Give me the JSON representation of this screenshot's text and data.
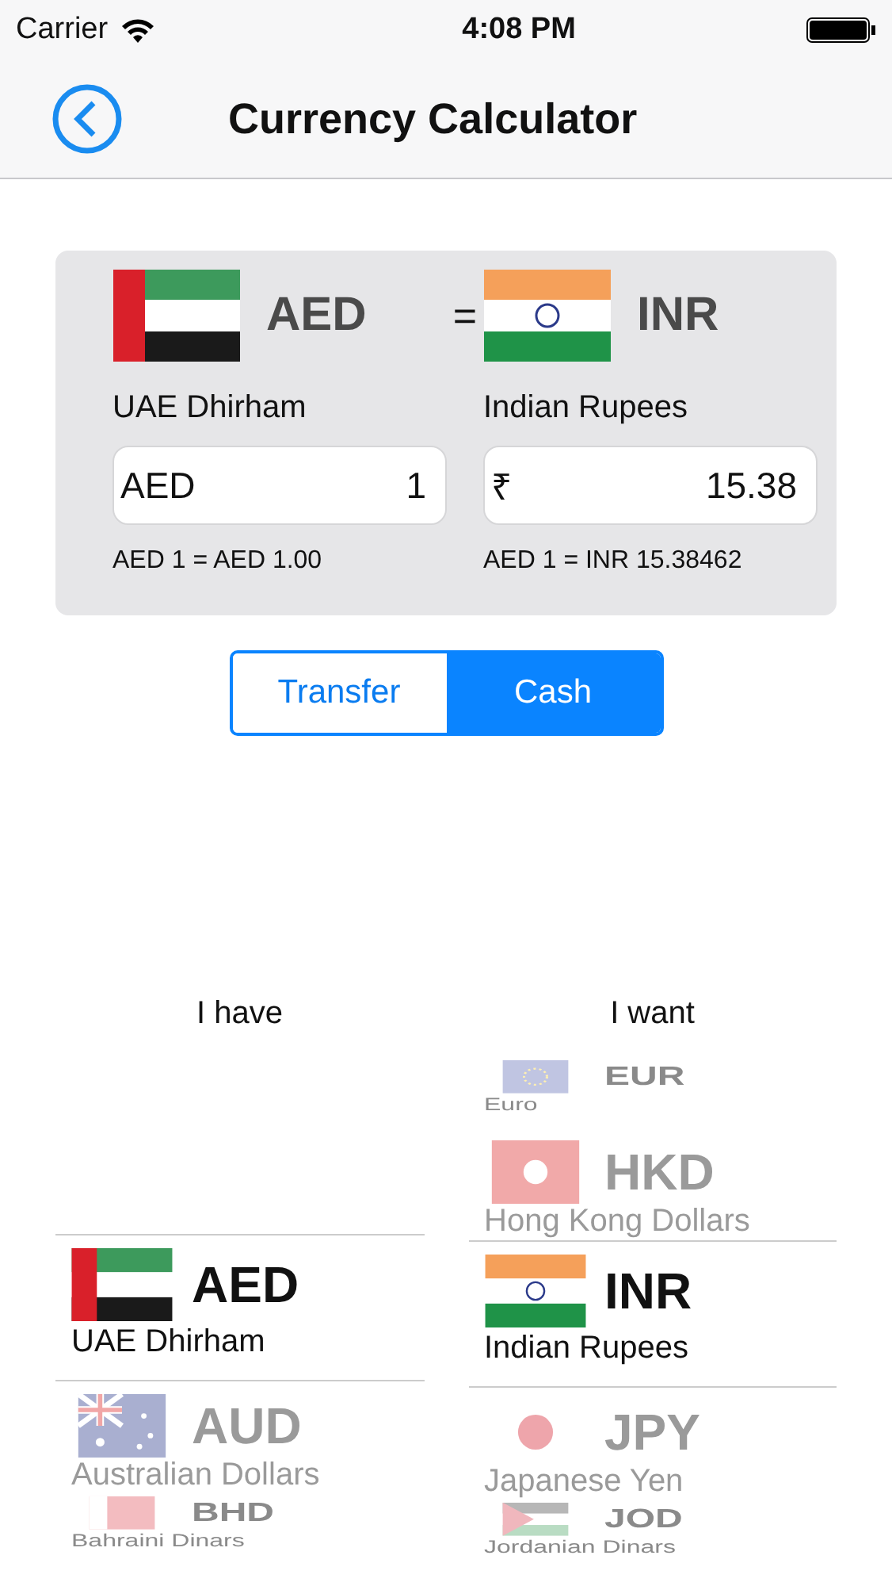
{
  "status_bar": {
    "carrier": "Carrier",
    "time": "4:08 PM"
  },
  "nav": {
    "title": "Currency Calculator"
  },
  "converter": {
    "from": {
      "kind": "uae",
      "code": "AED",
      "name": "UAE Dhirham",
      "prefix": "AED",
      "value": "1",
      "rate": "AED 1 = AED 1.00"
    },
    "equals": "=",
    "to": {
      "kind": "india",
      "code": "INR",
      "name": "Indian Rupees",
      "prefix": "₹",
      "value": "15.38",
      "rate": "AED 1 = INR 15.38462"
    }
  },
  "segments": [
    {
      "label": "Transfer",
      "selected": false
    },
    {
      "label": "Cash",
      "selected": true
    }
  ],
  "pickers": [
    {
      "label": "I have",
      "items": [
        {
          "kind": "uae",
          "code": "AED",
          "name": "UAE Dhirham",
          "selected": true
        },
        {
          "kind": "australia",
          "code": "AUD",
          "name": "Australian Dollars",
          "selected": false
        },
        {
          "kind": "bahrain",
          "code": "BHD",
          "name": "Bahraini Dinars",
          "selected": false
        }
      ]
    },
    {
      "label": "I want",
      "items": [
        {
          "kind": "eu",
          "code": "EUR",
          "name": "Euro",
          "selected": false
        },
        {
          "kind": "hongkong",
          "code": "HKD",
          "name": "Hong Kong Dollars",
          "selected": false
        },
        {
          "kind": "india",
          "code": "INR",
          "name": "Indian Rupees",
          "selected": true
        },
        {
          "kind": "japan",
          "code": "JPY",
          "name": "Japanese Yen",
          "selected": false
        },
        {
          "kind": "jordan",
          "code": "JOD",
          "name": "Jordanian Dinars",
          "selected": false
        }
      ]
    }
  ]
}
